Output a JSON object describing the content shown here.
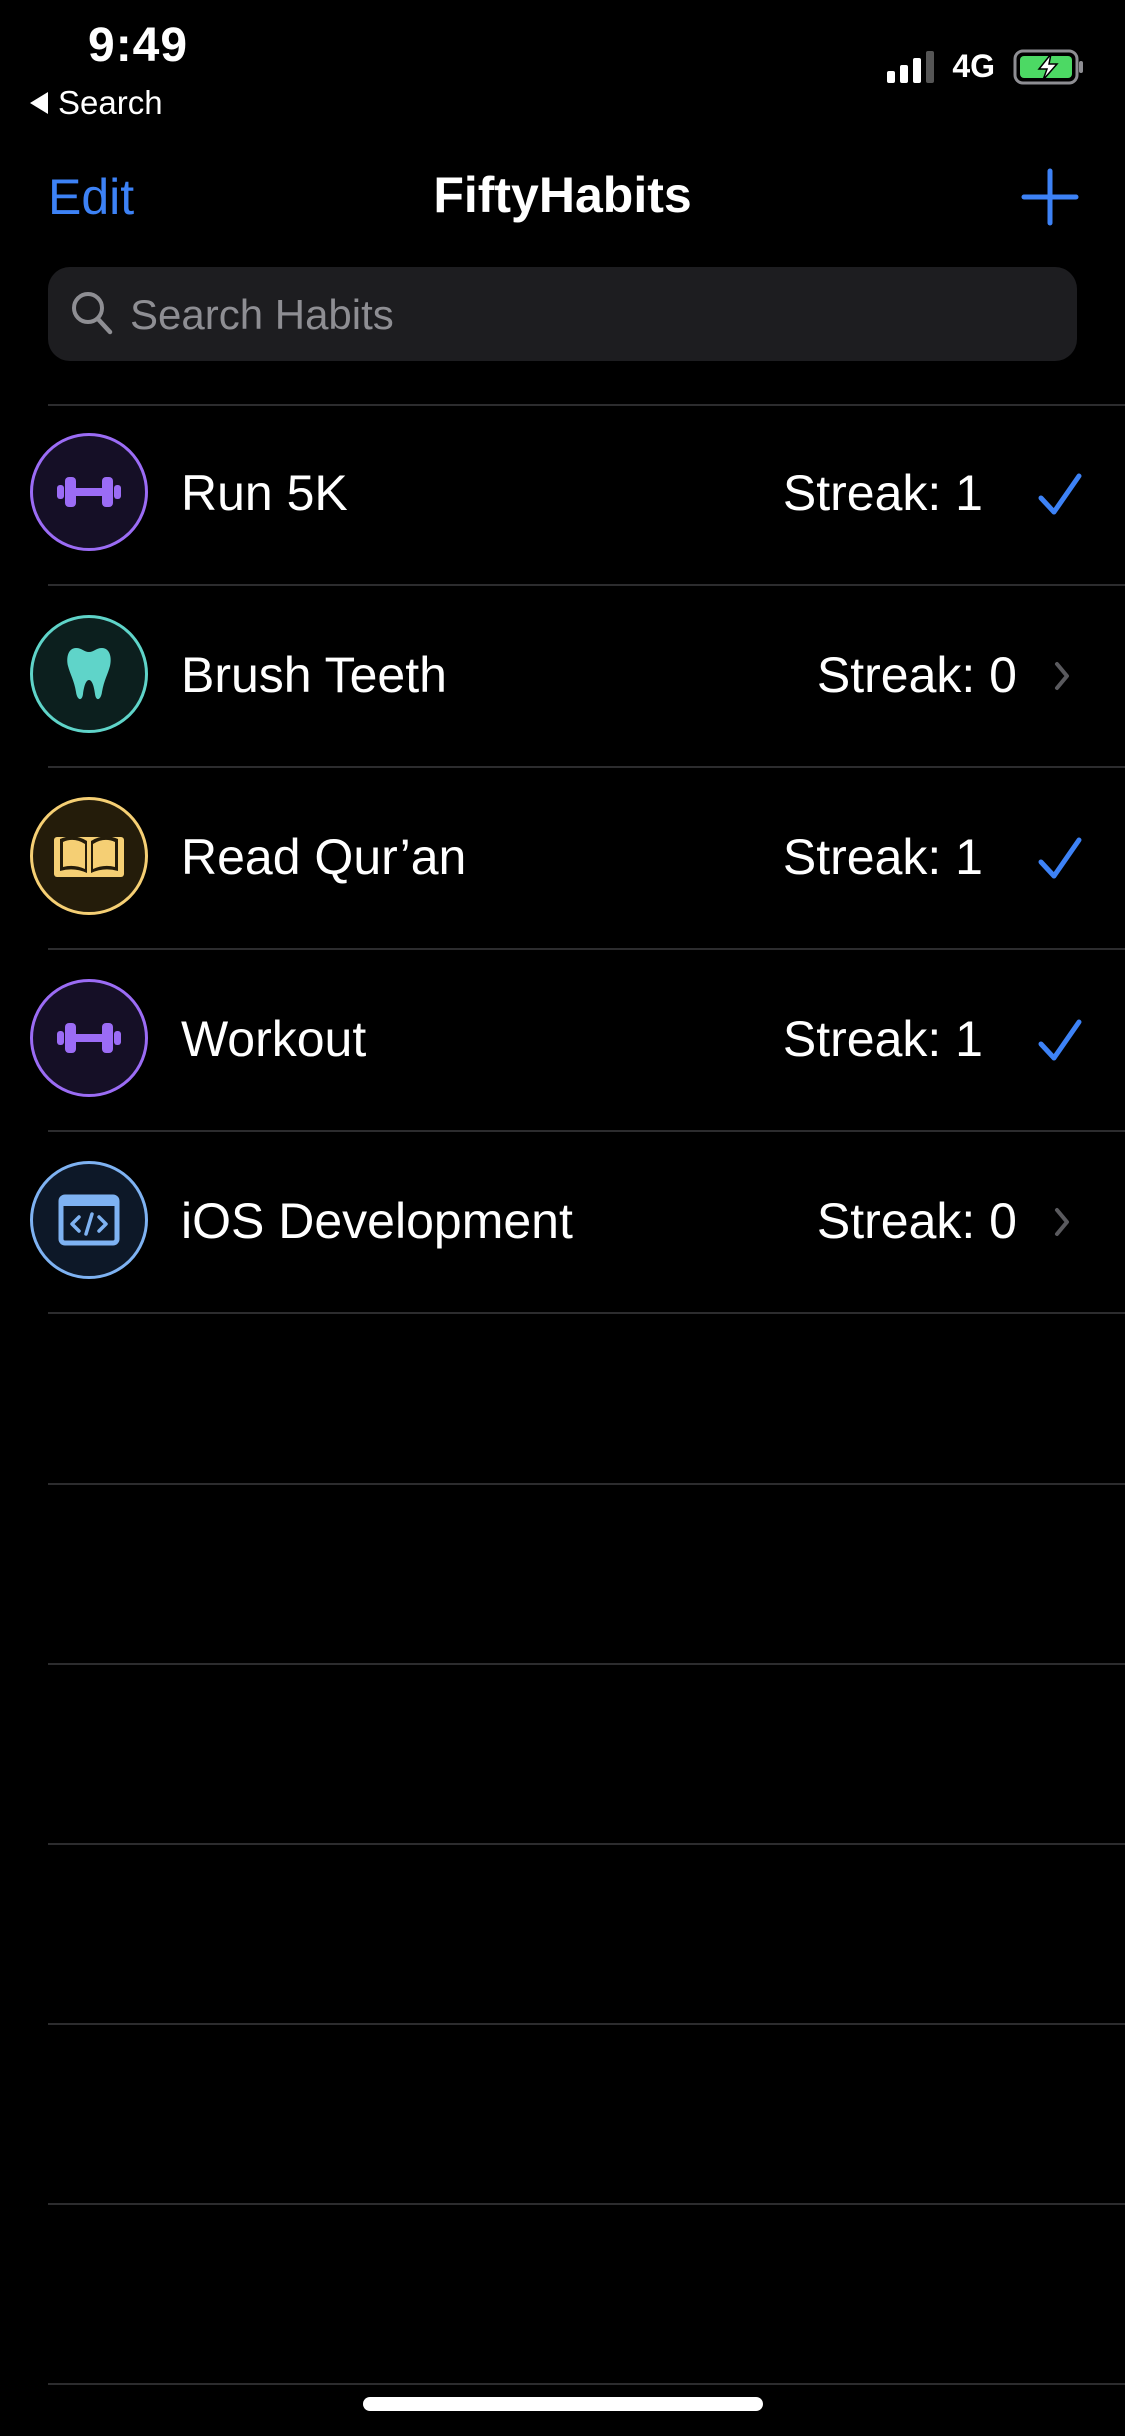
{
  "status_bar": {
    "time": "9:49",
    "back_label": "Search",
    "network": "4G"
  },
  "nav": {
    "edit_label": "Edit",
    "title": "FiftyHabits",
    "add_icon": "plus-icon"
  },
  "search": {
    "placeholder": "Search Habits",
    "value": ""
  },
  "colors": {
    "accent": "#3d82f6",
    "purple": "#9b6cf5",
    "teal": "#5fd4c9",
    "yellow": "#f5cf74",
    "blue": "#7eb2f2"
  },
  "habits": [
    {
      "name": "Run 5K",
      "streak": "Streak: 1",
      "done": true,
      "icon": "dumbbell-icon"
    },
    {
      "name": "Brush Teeth",
      "streak": "Streak: 0",
      "done": false,
      "icon": "tooth-icon"
    },
    {
      "name": "Read Qur’an",
      "streak": "Streak: 1",
      "done": true,
      "icon": "book-icon"
    },
    {
      "name": "Workout",
      "streak": "Streak: 1",
      "done": true,
      "icon": "dumbbell-icon"
    },
    {
      "name": "iOS Development",
      "streak": "Streak: 0",
      "done": false,
      "icon": "code-window-icon"
    }
  ]
}
